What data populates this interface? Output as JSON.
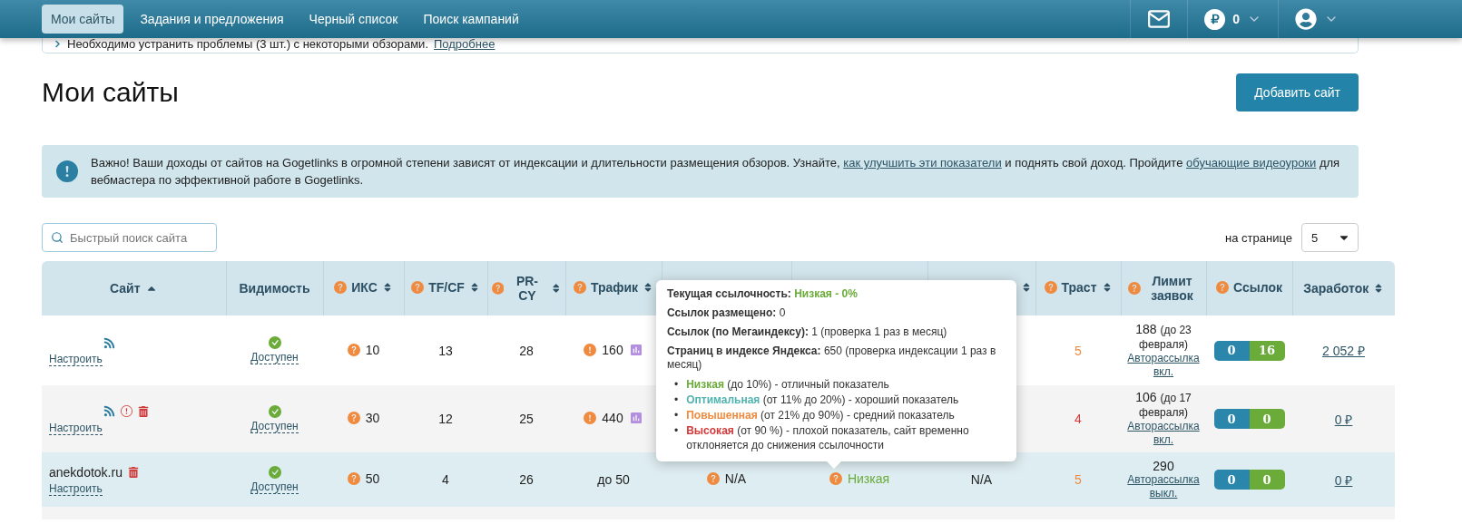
{
  "nav": {
    "items": [
      {
        "label": "Мои сайты",
        "selected": true
      },
      {
        "label": "Задания и предложения",
        "selected": false
      },
      {
        "label": "Черный список",
        "selected": false
      },
      {
        "label": "Поиск кампаний",
        "selected": false
      }
    ],
    "balance": "0"
  },
  "notice": {
    "text": "Необходимо устранить проблемы (3 шт.) с некоторыми обзорами.",
    "link": "Подробнее"
  },
  "title": "Мои сайты",
  "add_button": "Добавить сайт",
  "alert": {
    "parts": [
      {
        "kind": "text",
        "text": "Важно! Ваши доходы от сайтов на Gogetlinks в огромной степени зависят от индексации и длительности размещения обзоров. Узнайте, "
      },
      {
        "kind": "link",
        "text": "как улучшить эти показатели"
      },
      {
        "kind": "text",
        "text": " и поднять свой доход. Пройдите "
      },
      {
        "kind": "link",
        "text": "обучающие видеоуроки"
      },
      {
        "kind": "text",
        "text": " для вебмастера по эффективной работе в Gogetlinks."
      }
    ]
  },
  "search": {
    "placeholder": "Быстрый поиск сайта"
  },
  "per_page": {
    "label": "на странице",
    "value": "5"
  },
  "table": {
    "columns": [
      {
        "label": "Сайт",
        "help": false,
        "sortable": true,
        "sorted": true
      },
      {
        "label": "Видимость",
        "help": false,
        "sortable": false
      },
      {
        "label": "ИКС",
        "help": true,
        "sortable": true,
        "sorted": false
      },
      {
        "label": "TF/CF",
        "help": true,
        "sortable": true,
        "sorted": false
      },
      {
        "label": "PR-CY",
        "help": true,
        "sortable": true,
        "sorted": false
      },
      {
        "label": "Трафик",
        "help": true,
        "sortable": true,
        "sorted": false
      },
      {
        "help": false,
        "sortable": false
      },
      {
        "help": false,
        "sortable": false
      },
      {
        "help": false,
        "sortable": true,
        "sorted": false
      },
      {
        "label": "Траст",
        "help": true,
        "sortable": true,
        "sorted": false
      },
      {
        "label": "Лимит заявок",
        "help": true,
        "sortable": false
      },
      {
        "label": "Ссылок",
        "help": true,
        "sortable": false
      },
      {
        "label": "Заработок",
        "help": false,
        "sortable": true,
        "sorted": false
      }
    ],
    "rows": [
      {
        "site": {
          "rss": true,
          "warning": false,
          "trash": false
        },
        "setup": "Настроить",
        "visibility": "Доступен",
        "iks": "10",
        "tfcf": "13",
        "prcy": "28",
        "traffic": {
          "value": "160",
          "alert": true,
          "chart": true
        },
        "trust": {
          "value": "5",
          "color": "#f08a3e"
        },
        "limit": {
          "count": "188",
          "until": "(до 23 февраля)",
          "mailing": "Авторассылка вкл."
        },
        "links": {
          "placed": "0",
          "total": "16"
        },
        "earnings": "2 052 ₽"
      },
      {
        "site": {
          "rss": true,
          "warning": true,
          "trash": true
        },
        "setup": "Настроить",
        "visibility": "Доступен",
        "iks": "30",
        "tfcf": "12",
        "prcy": "25",
        "traffic": {
          "value": "440",
          "alert": true,
          "chart": true
        },
        "trust": {
          "value": "4",
          "color": "#d23a3a"
        },
        "limit": {
          "count": "106",
          "until": "(до 17 февраля)",
          "mailing": "Авторассылка вкл."
        },
        "links": {
          "placed": "0",
          "total": "0"
        },
        "earnings": "0 ₽"
      },
      {
        "site": {
          "name": "anekdotok.ru",
          "rss": false,
          "warning": false,
          "trash": true
        },
        "setup": "Настроить",
        "visibility": "Доступен",
        "iks": "50",
        "tfcf": "4",
        "prcy": "26",
        "traffic": {
          "value": "до 50",
          "alert": false,
          "chart": false
        },
        "column_7": {
          "value": "N/A",
          "help": true
        },
        "column_8": {
          "value": "Низкая",
          "help": true,
          "color": "#6aab3a"
        },
        "column_9": {
          "value": "N/A",
          "help": false
        },
        "trust": {
          "value": "5",
          "color": "#f08a3e"
        },
        "limit": {
          "count": "290",
          "mailing": "Авторассылка выкл."
        },
        "links": {
          "placed": "0",
          "total": "0"
        },
        "earnings": "0 ₽"
      }
    ]
  },
  "tooltip": {
    "lines": [
      {
        "label": "Текущая ссылочность:",
        "value": "Низкая - 0%",
        "kind": "status",
        "color": "#6aab3a"
      },
      {
        "label": "Ссылок размещено:",
        "value": "0",
        "kind": "plain"
      },
      {
        "label": "Ссылок (по Мегаиндексу):",
        "value": "1 (проверка 1 раз в месяц)",
        "kind": "plain"
      },
      {
        "label": "Страниц в индексе Яндекса:",
        "value": "650 (проверка индексации 1 раз в месяц)",
        "kind": "plain"
      }
    ],
    "legend": [
      {
        "marker": "•",
        "name": "Низкая",
        "text": "(до 10%) - отличный показатель",
        "color": "#6aab3a"
      },
      {
        "marker": "•",
        "name": "Оптимальная",
        "text": "(от 11% до 20%) - хороший показатель",
        "color": "#4fb3b0"
      },
      {
        "marker": "•",
        "name": "Повышенная",
        "text": "(от 21% до 90%) - средний показатель",
        "color": "#f08a3e"
      },
      {
        "marker": "•",
        "name": "Высокая",
        "text": "(от 90 %) - плохой показатель, сайт временно отклоняется до снижения ссылочности",
        "color": "#d23a3a"
      }
    ]
  }
}
